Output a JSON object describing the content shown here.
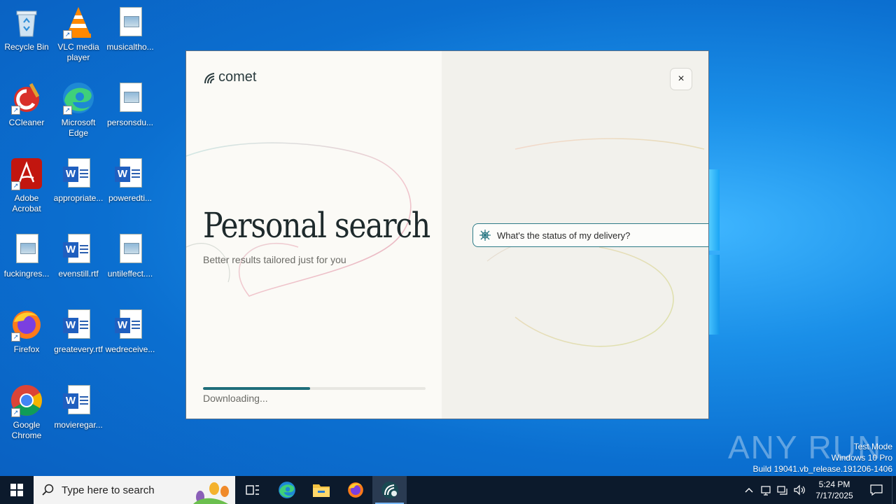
{
  "desktop": {
    "icons": [
      {
        "label": "Recycle Bin",
        "icon": "recycle-bin-icon"
      },
      {
        "label": "VLC media player",
        "icon": "vlc-icon"
      },
      {
        "label": "musicaltho...",
        "icon": "image-file-icon"
      },
      {
        "label": "CCleaner",
        "icon": "ccleaner-icon"
      },
      {
        "label": "Microsoft Edge",
        "icon": "edge-icon"
      },
      {
        "label": "personsdu...",
        "icon": "image-file-icon"
      },
      {
        "label": "Adobe Acrobat",
        "icon": "acrobat-icon"
      },
      {
        "label": "appropriate...",
        "icon": "word-file-icon"
      },
      {
        "label": "poweredti...",
        "icon": "word-file-icon"
      },
      {
        "label": "fuckingres...",
        "icon": "image-file-icon"
      },
      {
        "label": "evenstill.rtf",
        "icon": "word-file-icon"
      },
      {
        "label": "untileffect....",
        "icon": "image-file-icon"
      },
      {
        "label": "Firefox",
        "icon": "firefox-icon"
      },
      {
        "label": "greatevery.rtf",
        "icon": "word-file-icon"
      },
      {
        "label": "wedreceive...",
        "icon": "word-file-icon"
      },
      {
        "label": "Google Chrome",
        "icon": "chrome-icon"
      },
      {
        "label": "movieregar...",
        "icon": "word-file-icon"
      }
    ]
  },
  "installer": {
    "brand": "comet",
    "close_label": "×",
    "headline": "Personal search",
    "subheadline": "Better results tailored just for you",
    "progress": 0.48,
    "progress_label": "Downloading...",
    "sample_query": "What's the status of my delivery?",
    "accent_color": "#1f6e7a"
  },
  "watermark": {
    "text": "ANY RUN",
    "mode": "Test Mode",
    "edition": "Windows 10 Pro",
    "build": "Build 19041.vb_release.191206-1406"
  },
  "taskbar": {
    "search_placeholder": "Type here to search",
    "apps": [
      "task-view-icon",
      "edge-icon",
      "file-explorer-icon",
      "firefox-icon",
      "comet-icon"
    ],
    "time": "5:24 PM",
    "date": "7/17/2025"
  }
}
